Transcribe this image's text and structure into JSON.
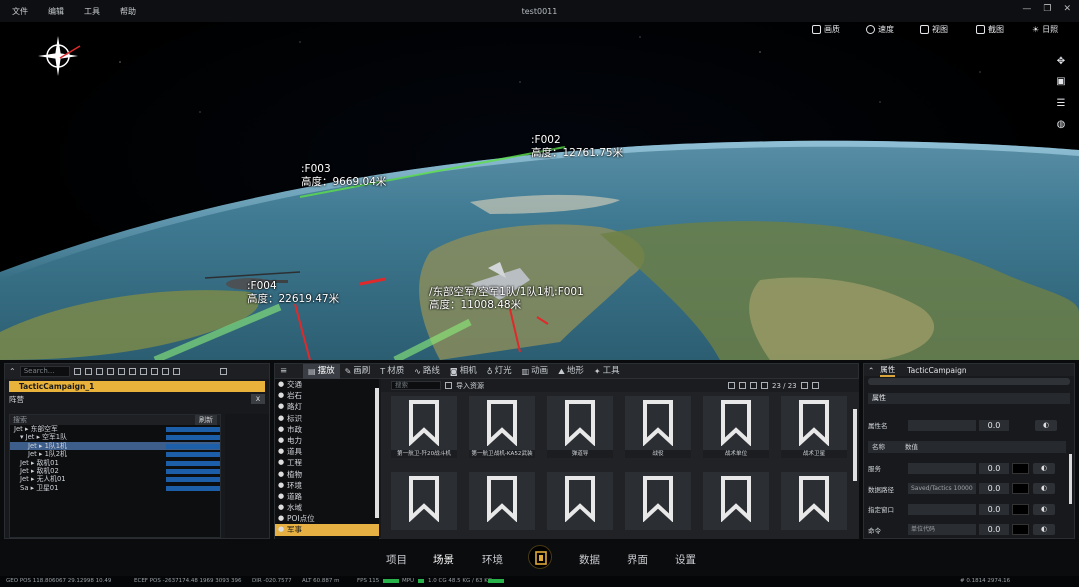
{
  "window": {
    "title": "test0011",
    "menu": [
      "文件",
      "编辑",
      "工具",
      "帮助"
    ]
  },
  "viewport_toolbar": [
    {
      "label": "画质",
      "icon": "picture-icon"
    },
    {
      "label": "速度",
      "icon": "speed-icon"
    },
    {
      "label": "视图",
      "icon": "view-icon"
    },
    {
      "label": "截图",
      "icon": "screenshot-icon"
    },
    {
      "label": "日照",
      "icon": "sun-icon"
    }
  ],
  "viewport_right_tools": [
    "move-icon",
    "cube-icon",
    "layers-icon",
    "globe-icon"
  ],
  "units": [
    {
      "name": ":F002",
      "altitude": "高度：12761.75米"
    },
    {
      "name": ":F003",
      "altitude": "高度：9669.04米"
    },
    {
      "name": ":F004",
      "altitude": "高度：22619.47米"
    },
    {
      "name": "/东部空军/空军1队/1队1机:F001",
      "altitude": "高度：11008.48米"
    }
  ],
  "left_panel": {
    "search_placeholder": "Search...",
    "campaign": "TacticCampaign_1",
    "inner_title": "阵营",
    "inner_close": "x",
    "tree_search_placeholder": "搜索",
    "tree_button": "刷新",
    "rows": [
      {
        "text": "Jet ▸  东部空军",
        "indent": 0
      },
      {
        "text": "▾ Jet ▸  空军1队",
        "indent": 6
      },
      {
        "text": "Jet ▸  1队1机",
        "indent": 14,
        "selected": true
      },
      {
        "text": "Jet ▸  1队2机",
        "indent": 14
      },
      {
        "text": "Jet ▸  敌机01",
        "indent": 6
      },
      {
        "text": "Jet ▸  敌机02",
        "indent": 6
      },
      {
        "text": "Jet ▸  无人机01",
        "indent": 6
      },
      {
        "text": "Sa ▸  卫星01",
        "indent": 6
      }
    ]
  },
  "center_panel": {
    "tabs": [
      {
        "label": "摆放",
        "icon": "place-icon",
        "active": true
      },
      {
        "label": "画刷",
        "icon": "brush-icon"
      },
      {
        "label": "材质",
        "icon": "material-icon"
      },
      {
        "label": "路线",
        "icon": "route-icon"
      },
      {
        "label": "相机",
        "icon": "camera-icon"
      },
      {
        "label": "灯光",
        "icon": "light-icon"
      },
      {
        "label": "动画",
        "icon": "animation-icon"
      },
      {
        "label": "地形",
        "icon": "terrain-icon"
      },
      {
        "label": "工具",
        "icon": "tool-icon"
      }
    ],
    "categories": [
      "交通",
      "岩石",
      "路灯",
      "标识",
      "市政",
      "电力",
      "道具",
      "工程",
      "植物",
      "环境",
      "道路",
      "水域",
      "POI点位",
      "军事"
    ],
    "selected_category": "军事",
    "search_placeholder": "搜索",
    "import_label": "导入资源",
    "count": "23 / 23",
    "tiles": [
      "第一航卫-歼20战斗机",
      "第一航卫战机-KA52武装",
      "弹道导",
      "战役",
      "战术单位",
      "战术卫星",
      "",
      "",
      "",
      "",
      "",
      ""
    ]
  },
  "right_panel": {
    "header": "属性",
    "object": "TacticCampaign",
    "section": "属性",
    "prop_name_label": "属性名",
    "col_name": "名称",
    "col_value": "数值",
    "rows": [
      {
        "name": "属性名",
        "value": "",
        "num": "0.0"
      },
      {
        "name": "服务",
        "value": "",
        "num": "0.0"
      },
      {
        "name": "数据路径",
        "value": "Saved/Tactics 10000",
        "num": "0.0"
      },
      {
        "name": "指定窗口",
        "value": "",
        "num": "0.0"
      },
      {
        "name": "命令",
        "value": "单位代码",
        "num": "0.0"
      }
    ]
  },
  "bottom_nav": {
    "items": [
      "项目",
      "场景",
      "环境",
      "数据",
      "界面",
      "设置"
    ],
    "active": "场景"
  },
  "status": {
    "geo_pos": "GEO POS  118.806067 29.12998 10.49",
    "ecef_pos": "ECEF POS  -2637174.48 1969 3093 396",
    "dir": "DIR  -020.7577",
    "alt": "ALT  60.887 m",
    "fps": "FPS  115",
    "mpu": "MPU",
    "mem": "1.0 CG  48.5 KG / 63 KG",
    "right": "# 0.1814 2974.16"
  }
}
